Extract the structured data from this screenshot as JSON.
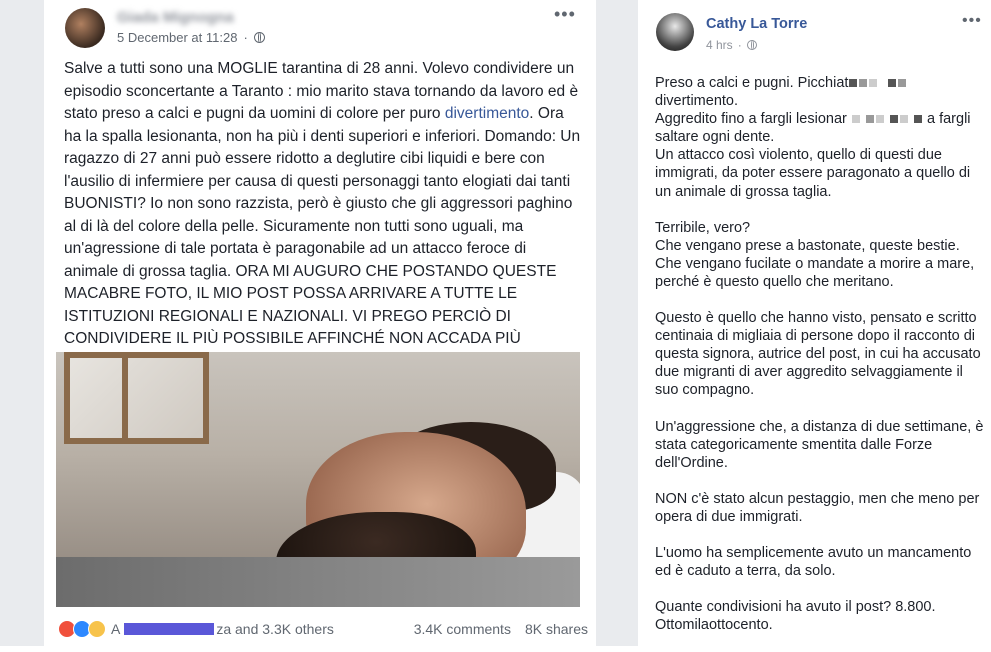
{
  "left_post": {
    "author": "Giada Mignogna",
    "timestamp": "5 December at 11:28",
    "body_before_link": "Salve a tutti sono una MOGLIE tarantina di 28 anni. Volevo condividere un episodio sconcertante a Taranto : mio marito stava tornando da lavoro ed è stato preso a calci e pugni da uomini di colore per puro ",
    "body_link": "divertimento",
    "body_after_link": ". Ora ha la spalla lesionanta, non ha più i denti superiori e inferiori. Domando: Un ragazzo di 27 anni può essere ridotto a deglutire cibi liquidi e bere con l'ausilio di infermiere per causa di questi personaggi tanto elogiati dai tanti BUONISTI? Io non sono razzista, però è giusto che gli aggressori paghino al di là del colore della pelle. Sicuramente non tutti sono uguali, ma un'agressione di tale portata è paragonabile ad un attacco feroce di animale di grossa taglia. ORA MI AUGURO CHE POSTANDO QUESTE MACABRE FOTO, IL MIO POST POSSA ARRIVARE A TUTTE LE ISTITUZIONI REGIONALI E NAZIONALI. VI PREGO PERCIÒ DI CONDIVIDERE IL PIÙ POSSIBILE AFFINCHÉ NON ACCADA PIÙ EPISODI SIMILI. GRAZIE PER L'AIUTO.",
    "reactions_prefix": "A",
    "reactions_suffix": "za and 3.3K others",
    "comments": "3.4K comments",
    "shares": "8K shares"
  },
  "right_post": {
    "author": "Cathy La Torre",
    "time": "4 hrs",
    "p1_a": "Preso a calci e pugni. Picchiat",
    "p1_b": "divertimento.",
    "p1_c": "Aggredito fino a fargli lesionar",
    "p1_d": "a fargli saltare ogni dente.",
    "p1_e": "Un attacco così violento, quello di questi due immigrati, da poter essere paragonato a quello di un animale di grossa taglia.",
    "p2": "Terribile, vero?",
    "p2b": "Che vengano prese a bastonate, queste bestie.",
    "p2c": "Che vengano fucilate o mandate a morire a mare, perché è questo quello che meritano.",
    "p3": "Questo è quello che hanno visto, pensato e scritto centinaia di migliaia di persone dopo il racconto di questa signora, autrice del post, in cui ha accusato due migranti di aver aggredito selvaggiamente il suo compagno.",
    "p4": "Un'aggressione che, a distanza di due settimane, è stata categoricamente smentita dalle Forze dell'Ordine.",
    "p5": "NON c'è stato alcun pestaggio, men che meno per opera di due immigrati.",
    "p6": "L'uomo ha semplicemente avuto un mancamento ed è caduto a terra, da solo.",
    "p7": "Quante condivisioni ha avuto il post? 8.800.",
    "p7b": "Ottomilaottocento."
  },
  "icons": {
    "more": "more-options-icon",
    "privacy": "globe-icon"
  },
  "colors": {
    "link": "#385898",
    "text": "#1d2129",
    "meta": "#90949c"
  }
}
